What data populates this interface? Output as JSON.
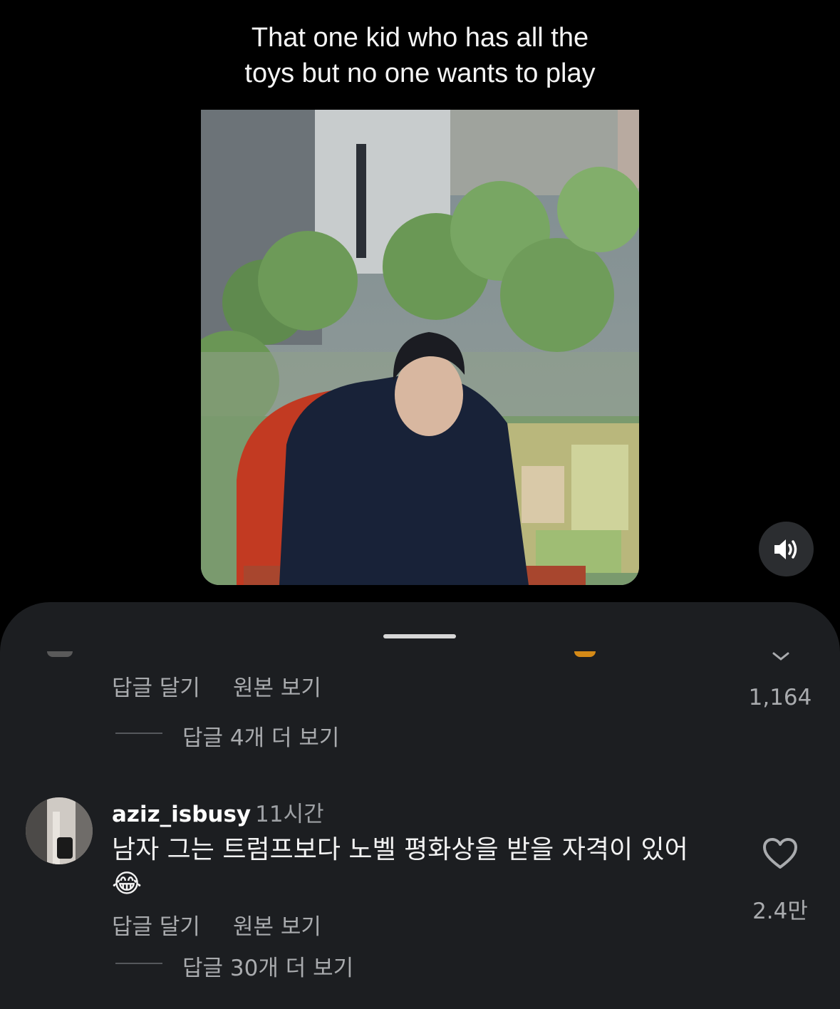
{
  "caption": {
    "line1": "That one kid who has all the",
    "line2": "toys but no one wants to play"
  },
  "video": {
    "sound_icon": "speaker-volume-icon"
  },
  "comments_sheet": {
    "previous_comment": {
      "reply_label": "답글 달기",
      "original_label": "원본 보기",
      "like_count": "1,164",
      "more_replies": "답글 4개 더 보기"
    },
    "comment": {
      "username": "aziz_isbusy",
      "time": "11시간",
      "text": "남자 그는 트럼프보다 노벨 평화상을 받을 자격이 있어",
      "emoji": "😂",
      "reply_label": "답글 달기",
      "original_label": "원본 보기",
      "like_count": "2.4만",
      "more_replies": "답글 30개 더 보기"
    }
  }
}
